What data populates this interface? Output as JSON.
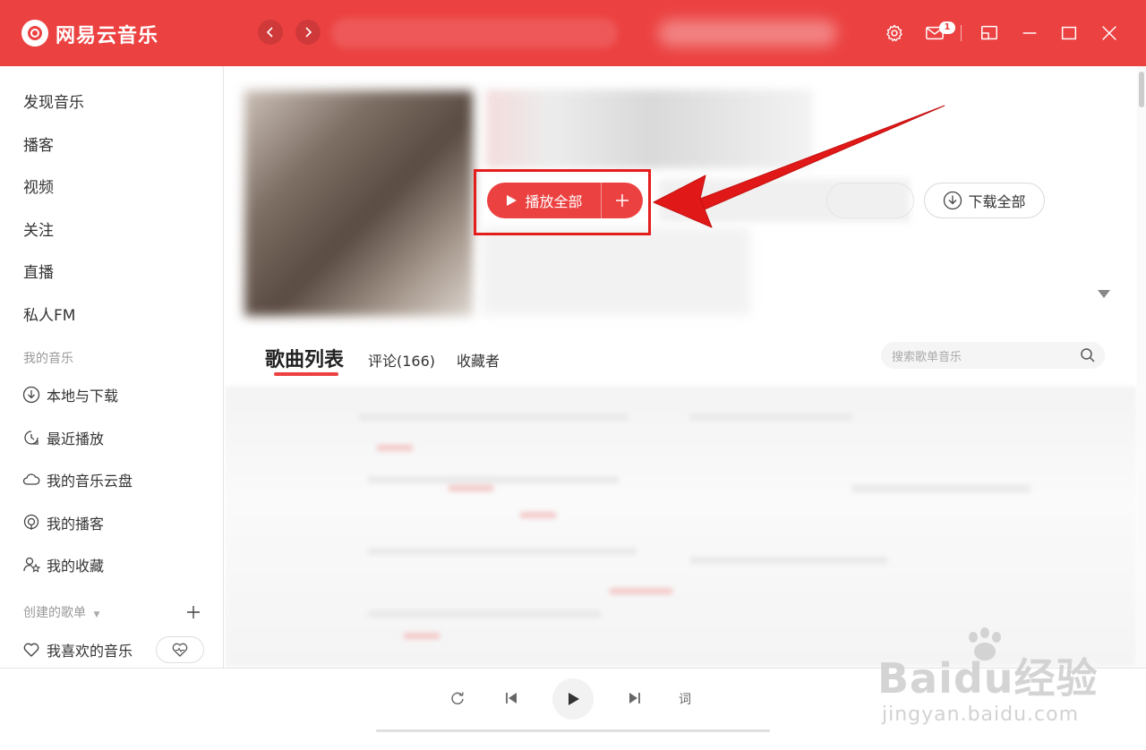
{
  "window": {
    "app_title": "网易云音乐",
    "mail_badge": "1"
  },
  "sidebar": {
    "main_items": [
      {
        "label": "发现音乐"
      },
      {
        "label": "播客"
      },
      {
        "label": "视频"
      },
      {
        "label": "关注"
      },
      {
        "label": "直播"
      },
      {
        "label": "私人FM"
      }
    ],
    "my_music_header": "我的音乐",
    "my_music_items": [
      {
        "label": "本地与下载",
        "icon": "download-icon"
      },
      {
        "label": "最近播放",
        "icon": "clock-icon"
      },
      {
        "label": "我的音乐云盘",
        "icon": "cloud-icon"
      },
      {
        "label": "我的播客",
        "icon": "podcast-icon"
      },
      {
        "label": "我的收藏",
        "icon": "favorites-icon"
      }
    ],
    "created_playlists_header": "创建的歌单",
    "liked_music_label": "我喜欢的音乐"
  },
  "playlist": {
    "play_all_label": "播放全部",
    "download_all_label": "下载全部",
    "tabs": {
      "song_list": "歌曲列表",
      "comments": "评论(166)",
      "collectors": "收藏者"
    },
    "search_placeholder": "搜索歌单音乐"
  },
  "player": {
    "lyric_label": "词"
  },
  "watermark": {
    "brand": "Baidu经验",
    "url": "jingyan.baidu.com"
  },
  "colors": {
    "accent": "#ec4141",
    "annotation": "#e51c1c"
  }
}
